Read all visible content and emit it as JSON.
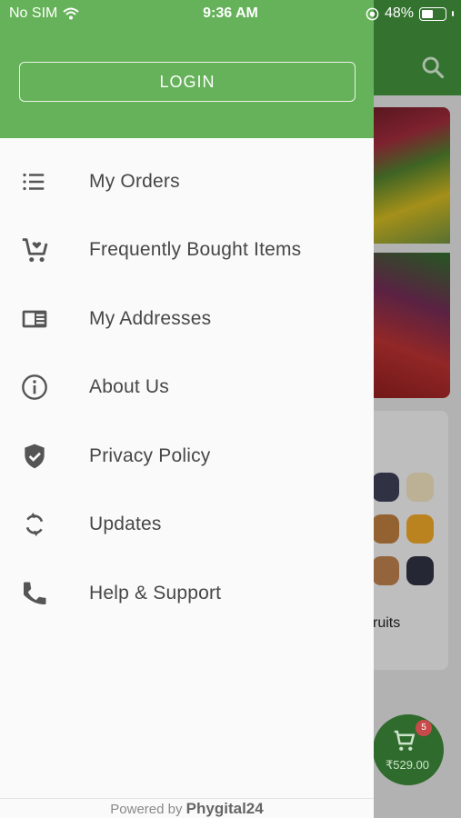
{
  "status_bar": {
    "carrier": "No SIM",
    "time": "9:36 AM",
    "battery_percent": "48%",
    "battery_level": 0.48
  },
  "drawer": {
    "login_label": "LOGIN",
    "menu_items": [
      {
        "label": "My Orders",
        "icon": "list-icon"
      },
      {
        "label": "Frequently Bought Items",
        "icon": "cart-heart-icon"
      },
      {
        "label": "My Addresses",
        "icon": "address-card-icon"
      },
      {
        "label": "About Us",
        "icon": "info-icon"
      },
      {
        "label": "Privacy Policy",
        "icon": "shield-check-icon"
      },
      {
        "label": "Updates",
        "icon": "sync-icon"
      },
      {
        "label": "Help & Support",
        "icon": "phone-icon"
      }
    ],
    "footer_prefix": "Powered by",
    "footer_brand": "Phygital24"
  },
  "background": {
    "category_label_partial": "ruits",
    "cart_count": "5",
    "cart_total": "₹529.00"
  },
  "colors": {
    "drawer_header": "#66b25a",
    "app_header": "#3f8c3a",
    "cart_badge": "#c94a4a"
  }
}
